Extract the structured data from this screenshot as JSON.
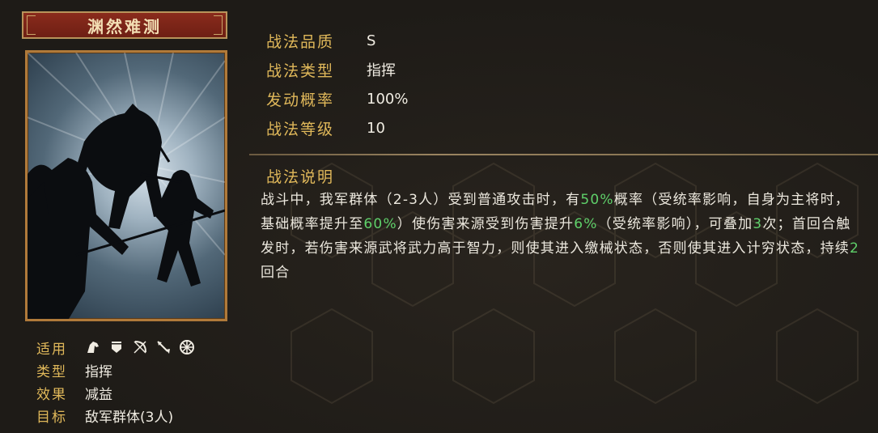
{
  "skill": {
    "name": "渊然难测"
  },
  "attributes": [
    {
      "key": "战法品质",
      "value": "S"
    },
    {
      "key": "战法类型",
      "value": "指挥"
    },
    {
      "key": "发动概率",
      "value": "100%"
    },
    {
      "key": "战法等级",
      "value": "10"
    }
  ],
  "description": {
    "title": "战法说明",
    "segments": [
      {
        "text": "战斗中，我军群体（2-3人）受到普通攻击时，有",
        "hl": false
      },
      {
        "text": "50%",
        "hl": true
      },
      {
        "text": "概率（受统率影响，自身为主将时，基础概率提升至",
        "hl": false
      },
      {
        "text": "60%",
        "hl": true
      },
      {
        "text": "）使伤害来源受到伤害提升",
        "hl": false
      },
      {
        "text": "6%",
        "hl": true
      },
      {
        "text": "（受统率影响），可叠加",
        "hl": false
      },
      {
        "text": "3",
        "hl": true
      },
      {
        "text": "次；首回合触发时，若伤害来源武将武力高于智力，则使其进入缴械状态，否则使其进入计穷状态，持续",
        "hl": false
      },
      {
        "text": "2",
        "hl": true
      },
      {
        "text": "回合",
        "hl": false
      }
    ]
  },
  "info": {
    "applicable": {
      "key": "适用",
      "icons": [
        "cavalry-icon",
        "shield-icon",
        "bow-icon",
        "spear-icon",
        "wheel-icon"
      ]
    },
    "type": {
      "key": "类型",
      "value": "指挥"
    },
    "effect": {
      "key": "效果",
      "value": "减益"
    },
    "target": {
      "key": "目标",
      "value": "敌军群体(3人)"
    }
  },
  "colors": {
    "gold": "#e0b85a",
    "highlight": "#5fd06a",
    "title_bg": "#8a2b1c"
  }
}
